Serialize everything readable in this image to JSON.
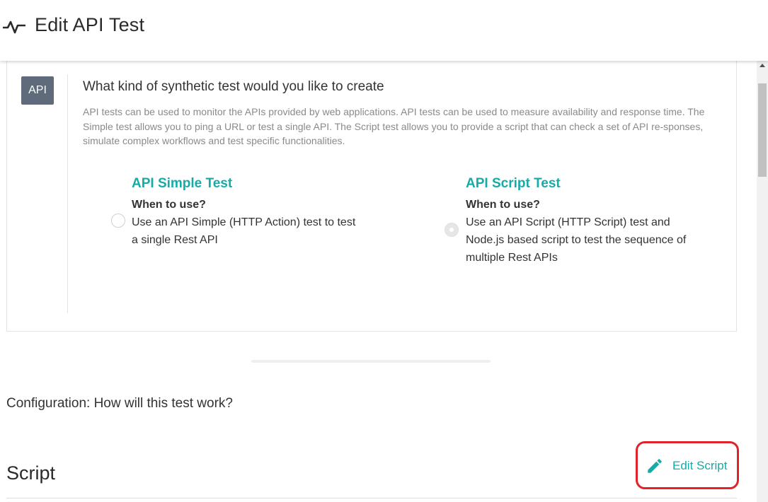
{
  "header": {
    "icon": "pulse-icon",
    "title": "Edit API Test"
  },
  "type_selector": {
    "badge": "API",
    "question": "What kind of synthetic test would you like to create",
    "description": "API tests can be used to monitor the APIs provided by web applications. API tests can be used to measure availability and response time. The Simple test allows you to ping a URL or test a single API. The Script test allows you to provide a script that can check a set of API re-sponses, simulate complex workflows and test specific functionalities.",
    "options": [
      {
        "title": "API Simple Test",
        "when": "When to use?",
        "desc": "Use an API Simple (HTTP Action) test to test a single Rest API",
        "selected": false
      },
      {
        "title": "API Script Test",
        "when": "When to use?",
        "desc": "Use an API Script (HTTP Script) test and Node.js based script to test the sequence of multiple Rest APIs",
        "selected": true
      }
    ]
  },
  "configuration": {
    "label": "Configuration: How will this test work?"
  },
  "script": {
    "heading": "Script",
    "edit_label": "Edit Script",
    "edit_icon": "pencil-icon"
  },
  "colors": {
    "accent": "#15aba9",
    "badge_bg": "#5f6b7a",
    "highlight": "#e0232a"
  }
}
